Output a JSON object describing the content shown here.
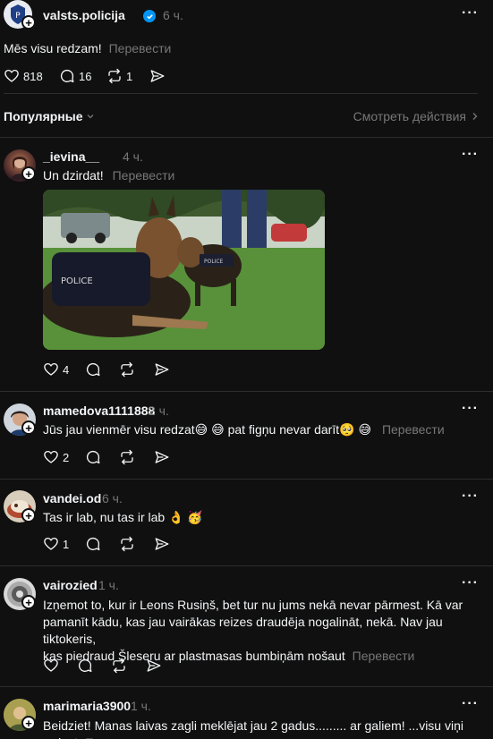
{
  "top_post": {
    "username": "valsts.policija",
    "time": "6 ч.",
    "text": "Mēs visu redzam!",
    "translate": "Перевести",
    "likes": "818",
    "comments": "16",
    "reposts": "1"
  },
  "filter": {
    "sort_label": "Популярные",
    "activity_link": "Смотреть действия"
  },
  "replies": [
    {
      "username": "_ievina__",
      "time": "4 ч.",
      "text": "Un dzirdat!",
      "translate": "Перевести",
      "likes": "4"
    },
    {
      "username": "mamedova1111888",
      "time": "2 ч.",
      "text": "Jūs jau vienmēr visu redzat😅 😅  pat figņu nevar darīt🥺 😅",
      "translate": "Перевести",
      "likes": "2"
    },
    {
      "username": "vandei.od",
      "time": "6 ч.",
      "text": "Tas ir lab, nu tas ir lab 👌 🥳",
      "likes": "1"
    },
    {
      "username": "vairozied",
      "time": "1 ч.",
      "text_line1": "Izņemot to, kur ir Leons Rusiņš, bet tur nu jums nekā nevar pārmest. Kā var",
      "text_line2": "pamanīt kādu, kas jau vairākas reizes draudēja nogalināt, nekā. Nav jau tiktokeris,",
      "text_line3": "kas piedraud Šleseru ar plastmasas bumbiņām nošaut",
      "translate": "Перевести"
    },
    {
      "username": "marimaria3900",
      "time": "1 ч.",
      "text_line1": "Beidziet! Manas laivas zagli meklējat jau 2 gadus......... ar galiem! ...visu viņi",
      "text_line2": "redzat",
      "translate": "Пе"
    }
  ]
}
